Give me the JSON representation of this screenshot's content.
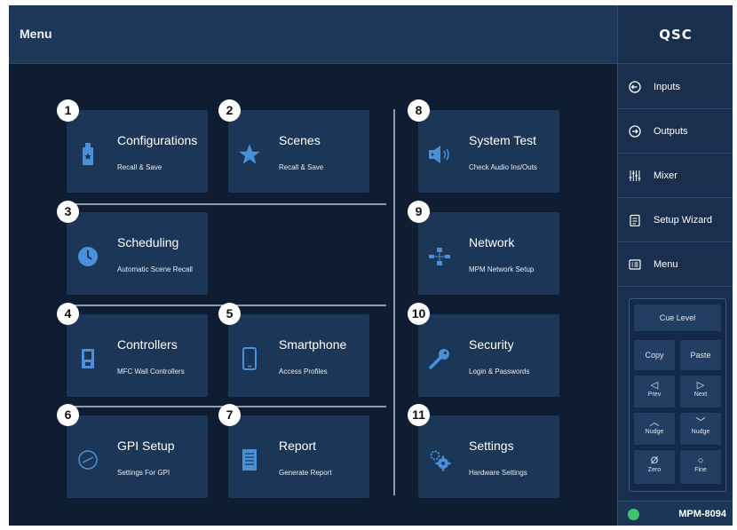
{
  "header": {
    "title": "Menu"
  },
  "brand": {
    "logo_text": "QSC"
  },
  "tiles": [
    {
      "id": "configurations",
      "badge": "1",
      "name": "Configurations",
      "subtitle": "Recall & Save",
      "icon": "usb-drive-icon"
    },
    {
      "id": "scenes",
      "badge": "2",
      "name": "Scenes",
      "subtitle": "Recall & Save",
      "icon": "star-icon"
    },
    {
      "id": "scheduling",
      "badge": "3",
      "name": "Scheduling",
      "subtitle": "Automatic Scene Recall",
      "icon": "clock-icon"
    },
    {
      "id": "controllers",
      "badge": "4",
      "name": "Controllers",
      "subtitle": "MFC Wall Controllers",
      "icon": "wall-controller-icon"
    },
    {
      "id": "smartphone",
      "badge": "5",
      "name": "Smartphone",
      "subtitle": "Access Profiles",
      "icon": "smartphone-icon"
    },
    {
      "id": "gpi-setup",
      "badge": "6",
      "name": "GPI Setup",
      "subtitle": "Settings For GPI",
      "icon": "gauge-icon"
    },
    {
      "id": "report",
      "badge": "7",
      "name": "Report",
      "subtitle": "Generate Report",
      "icon": "document-icon"
    },
    {
      "id": "system-test",
      "badge": "8",
      "name": "System Test",
      "subtitle": "Check Audio Ins/Outs",
      "icon": "speaker-icon"
    },
    {
      "id": "network",
      "badge": "9",
      "name": "Network",
      "subtitle": "MPM Network Setup",
      "icon": "network-icon"
    },
    {
      "id": "security",
      "badge": "10",
      "name": "Security",
      "subtitle": "Login & Passwords",
      "icon": "key-icon"
    },
    {
      "id": "settings",
      "badge": "11",
      "name": "Settings",
      "subtitle": "Hardware Settings",
      "icon": "gears-icon"
    }
  ],
  "sidebar": {
    "items": [
      {
        "id": "inputs",
        "label": "Inputs",
        "icon": "input-arrow-icon"
      },
      {
        "id": "outputs",
        "label": "Outputs",
        "icon": "output-arrow-icon"
      },
      {
        "id": "mixer",
        "label": "Mixer",
        "icon": "mixer-faders-icon"
      },
      {
        "id": "setup-wizard",
        "label": "Setup Wizard",
        "icon": "clipboard-icon"
      },
      {
        "id": "menu",
        "label": "Menu",
        "icon": "menu-list-icon"
      }
    ]
  },
  "cue": {
    "level_label": "Cue Level",
    "copy_label": "Copy",
    "paste_label": "Paste",
    "prev_glyph": "◁",
    "prev_label": "Prev",
    "next_glyph": "▷",
    "next_label": "Next",
    "nudge_up_glyph": "︿",
    "nudge_up_label": "Nudge",
    "nudge_down_glyph": "﹀",
    "nudge_down_label": "Nudge",
    "zero_glyph": "Ø",
    "zero_label": "Zero",
    "fine_glyph": "○",
    "fine_label": "Fine"
  },
  "status": {
    "model": "MPM-8094"
  },
  "colors": {
    "background": "#0f1d33",
    "header": "#1d3759",
    "tile": "#1c3657",
    "icon_accent": "#4a90d9",
    "wifi_ok": "#3ec46d"
  }
}
